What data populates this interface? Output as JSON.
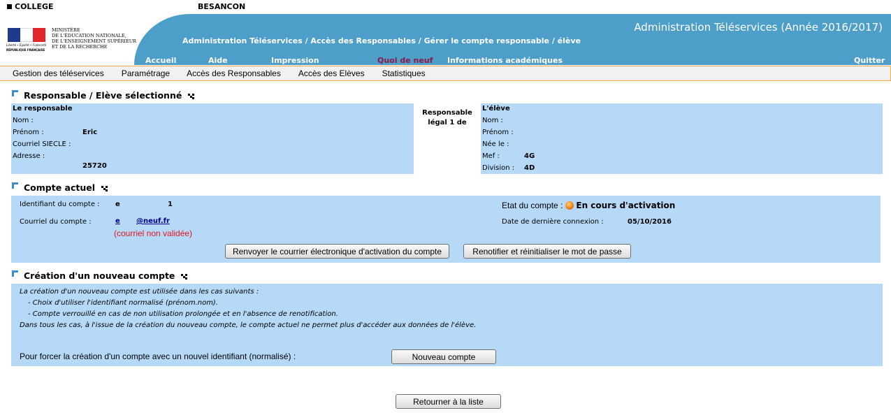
{
  "header": {
    "college": "COLLEGE",
    "city": "BESANCON",
    "logo": {
      "motto": "Liberté • Égalité • Fraternité",
      "republic": "RÉPUBLIQUE FRANÇAISE",
      "ministry_lines": [
        "MINISTÈRE",
        "DE L'ÉDUCATION NATIONALE,",
        "DE L'ENSEIGNEMENT SUPÉRIEUR",
        "ET DE LA RECHERCHE"
      ]
    },
    "app_title": "Administration Téléservices (Année 2016/2017)",
    "breadcrumb": "Administration Téléservices / Accès des Responsables / Gérer le compte responsable / élève",
    "nav": {
      "accueil": "Accueil",
      "aide": "Aide",
      "impression": "Impression",
      "quoi_de_neuf": "Quoi de neuf",
      "infos": "Informations académiques",
      "quitter": "Quitter"
    }
  },
  "menu": {
    "gestion": "Gestion des téléservices",
    "parametrage": "Paramétrage",
    "acces_responsables": "Accès des Responsables",
    "acces_eleves": "Accès des Elèves",
    "statistiques": "Statistiques"
  },
  "selected": {
    "title": "Responsable / Elève sélectionné",
    "relation": "Responsable légal 1 de",
    "responsable": {
      "heading": "Le responsable",
      "nom_label": "Nom :",
      "prenom_label": "Prénom :",
      "prenom_value": "Eric",
      "courriel_label": "Courriel SIECLE :",
      "adresse_label": "Adresse :",
      "adresse_value": "25720"
    },
    "eleve": {
      "heading": "L'élève",
      "nom_label": "Nom :",
      "prenom_label": "Prénom :",
      "nee_label": "Née le :",
      "mef_label": "Mef :",
      "mef_value": "4G",
      "division_label": "Division :",
      "division_value": "4D"
    }
  },
  "account": {
    "title": "Compte actuel",
    "identifiant_label": "Identifiant du compte :",
    "identifiant_part1": "e",
    "identifiant_part2": "1",
    "courriel_label": "Courriel du compte :",
    "courriel_part1": "e",
    "courriel_part2": "@neuf.fr",
    "courriel_status": "(courriel non validée)",
    "etat_label": "Etat du compte :",
    "etat_value": "En cours d'activation",
    "derniere_label": "Date de dernière connexion :",
    "derniere_value": "05/10/2016",
    "btn_renvoyer": "Renvoyer le courrier électronique d'activation du compte",
    "btn_renotifier": "Renotifier et réinitialiser le mot de passe",
    "status_color": "#f07a10"
  },
  "new_account": {
    "title": "Création d'un nouveau compte",
    "lines": [
      "La création d'un nouveau compte est utilisée dans les cas suivants :",
      "- Choix d'utiliser l'identifiant normalisé (prénom.nom).",
      "- Compte verrouillé en cas de non utilisation prolongée et en l'absence de renotification.",
      "Dans tous les cas, à l'issue de la création du nouveau compte, le compte actuel ne permet plus d'accéder aux données de l'élève."
    ],
    "force_label": "Pour forcer la création d'un compte avec un nouvel identifiant (normalisé) :",
    "btn_nouveau": "Nouveau compte"
  },
  "footer": {
    "btn_retour": "Retourner à la liste"
  },
  "colors": {
    "banner": "#4d9ec8",
    "panel": "#b5d9f7",
    "menu_border": "#f4a54a",
    "highlight_nav": "#8b1a4a",
    "section_icon": "#3c8fd0"
  }
}
